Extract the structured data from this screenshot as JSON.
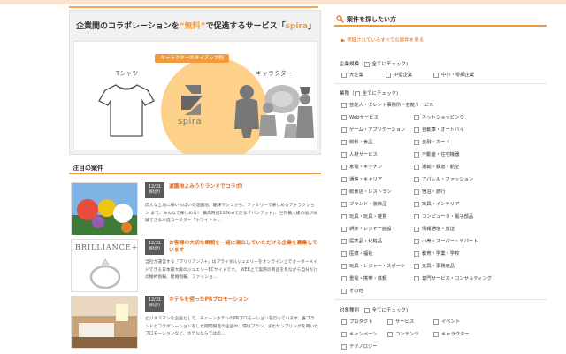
{
  "banner": {
    "title_pre": "企業間のコラボレーションを",
    "title_accent": "“無料”",
    "title_mid": "で促進するサービス「",
    "title_brand": "spira",
    "title_post": "」",
    "tie_label": "キャラクターのタイアップ例",
    "left_label": "Tシャツ",
    "right_label": "キャラクター",
    "logo_text": "spira",
    "colors": {
      "accent": "#f39a3c",
      "circle": "#fdd18a"
    }
  },
  "main": {
    "section_title": "注目の案件",
    "articles": [
      {
        "date": "12/31",
        "status": "締切り",
        "title": "遊園地よみうりランドでコラボ！",
        "text": "広大な土地に様いっぱいの遊園地。趣味マシンから、ファミリーで楽しめるアトラクション まで、みんなで楽しめる！ 最高時速110kmで走る「バンデット」、世界最大級の幅が体験できる木造コースター「ホワイトキ…"
      },
      {
        "date": "12/31",
        "status": "締切り",
        "title": "お客様の大切な瞬間を一緒に演出していただける企業を募集しています",
        "text": "当社が運営する「ブリリアンス+」はブライダルジュエリーをオンライン上でオーダーメイドできる日本最大級のジュエリーECサイトです。 WEB上で実際の商品を見ながら自分だけの婚約指輪、結婚指輪、ファッショ…"
      },
      {
        "date": "12/31",
        "status": "締切り",
        "title": "ホテルを使ったPRプロモーション",
        "text": "ビジネスマンを企画として、チェーンホテルのPRプロモーションを行っています。各ブランドとコラボレーションをした期間限定の企画や、環境プラン、またサンプリングを用いたプロモーションなど、ホテルならではの…"
      }
    ]
  },
  "sidebar": {
    "title": "案件を探したい方",
    "all_link": "登録されているすべての案件を見る",
    "groups": [
      {
        "label": "企業規模（",
        "check_all": "全てにチェック)",
        "options": [
          "大企業",
          "中堅企業",
          "中小・零細企業"
        ]
      },
      {
        "label": "業種（",
        "check_all": "全てにチェック)",
        "options": [
          "芸能人・タレント事務所・芸能サービス",
          "Webサービス",
          "ネットショッピング",
          "ゲーム・アプリケーション",
          "自動車・オートバイ",
          "飲料・食品",
          "金融・カード",
          "人材サービス",
          "不動産・住宅機器",
          "家電・キッチン",
          "運輸・鉄道・航空",
          "通信・キャリア",
          "アパレル・ファッション",
          "飲食店・レストラン",
          "宿泊・旅行",
          "ブランド・装飾品",
          "家具・インテリア",
          "玩具・玩具・雑貨",
          "コンピュータ・電子部品",
          "娯楽・レジャー施設",
          "情報通信・放送",
          "医薬品・化粧品",
          "小売・スーパー・デパート",
          "医療・福祉",
          "教育・学業・学校",
          "玩具・レジャー・スポーツ",
          "文具・事務用品",
          "重電・携帯・鉄鋼",
          "専門サービス・コンサルティング",
          "その他"
        ]
      },
      {
        "label": "対象種別（",
        "check_all": "全てにチェック)",
        "options": [
          "プロダクト",
          "サービス",
          "イベント",
          "キャンペーン",
          "コンテンツ",
          "キャラクター",
          "テクノロジー"
        ]
      }
    ]
  }
}
